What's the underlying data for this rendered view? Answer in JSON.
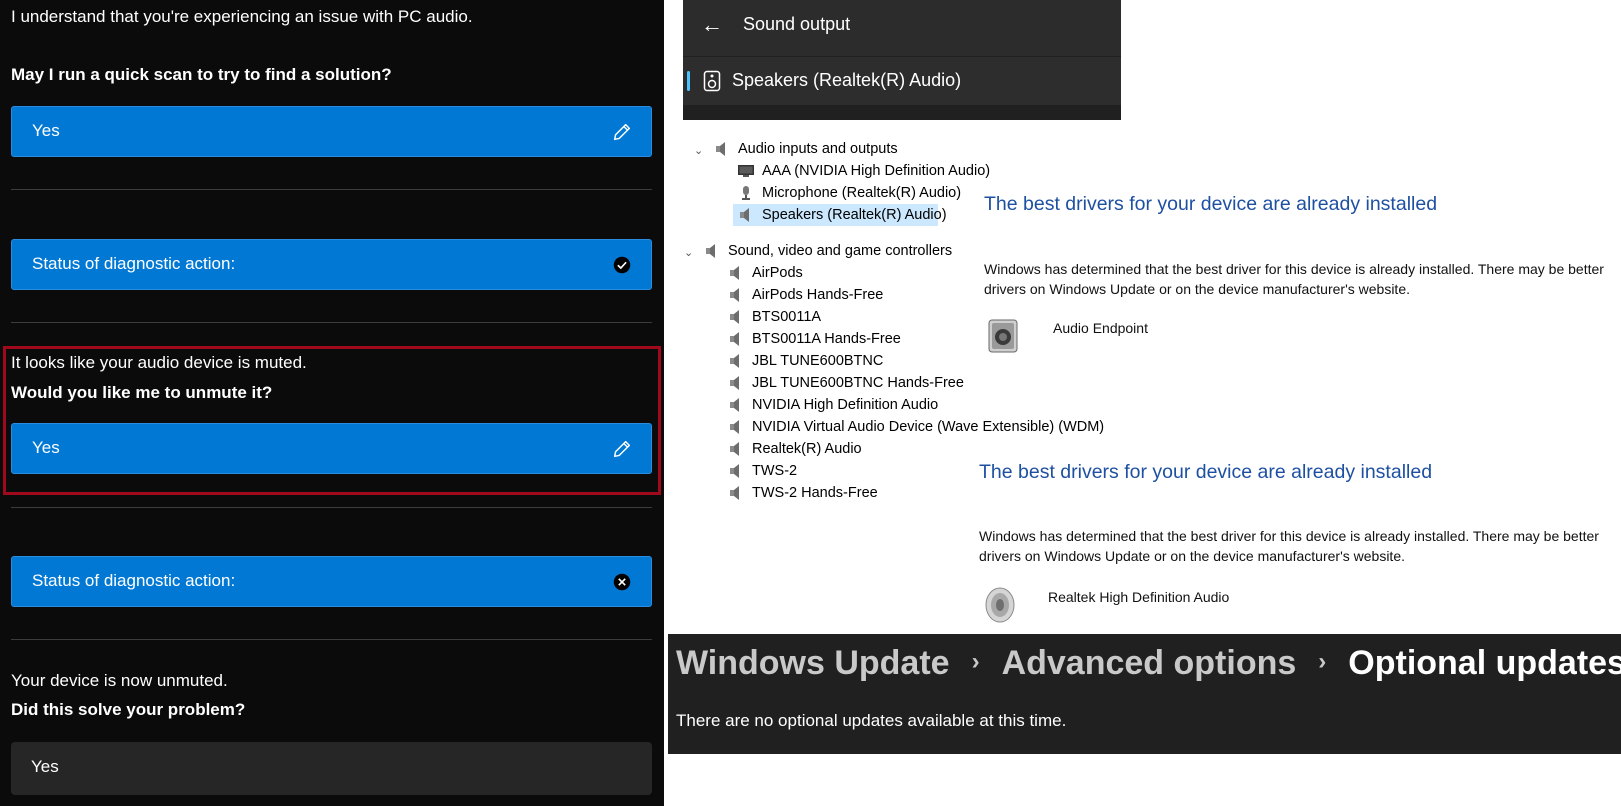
{
  "chat": {
    "intro": "I understand that you're experiencing an issue with PC audio.",
    "q1": "May I run a quick scan to try to find a solution?",
    "a1": "Yes",
    "status1": "Status of diagnostic action:",
    "muted_text": "It looks like your audio device is muted.",
    "q2": "Would you like me to unmute it?",
    "a2": "Yes",
    "status2": "Status of diagnostic action:",
    "unmuted_text": "Your device is now unmuted.",
    "q3": "Did this solve your problem?",
    "a3": "Yes"
  },
  "sound_output": {
    "title": "Sound output",
    "device": "Speakers (Realtek(R) Audio)"
  },
  "device_tree": {
    "group1": "Audio inputs and outputs",
    "group1_items": [
      "AAA (NVIDIA High Definition Audio)",
      "Microphone (Realtek(R) Audio)",
      "Speakers (Realtek(R) Audio)"
    ],
    "group2": "Sound, video and game controllers",
    "group2_items": [
      "AirPods",
      "AirPods Hands-Free",
      "BTS0011A",
      "BTS0011A Hands-Free",
      "JBL TUNE600BTNC",
      "JBL TUNE600BTNC Hands-Free",
      "NVIDIA High Definition Audio",
      "NVIDIA Virtual Audio Device (Wave Extensible) (WDM)",
      "Realtek(R) Audio",
      "TWS-2",
      "TWS-2 Hands-Free"
    ]
  },
  "driver1": {
    "title": "The best drivers for your device are already installed",
    "body": "Windows has determined that the best driver for this device is already installed. There may be better drivers on Windows Update or on the device manufacturer's website.",
    "device": "Audio Endpoint"
  },
  "driver2": {
    "title": "The best drivers for your device are already installed",
    "body": "Windows has determined that the best driver for this device is already installed. There may be better drivers on Windows Update or on the device manufacturer's website.",
    "device": "Realtek High Definition Audio"
  },
  "windows_update": {
    "crumb1": "Windows Update",
    "crumb2": "Advanced options",
    "crumb3": "Optional updates",
    "note": "There are no optional updates available at this time."
  }
}
